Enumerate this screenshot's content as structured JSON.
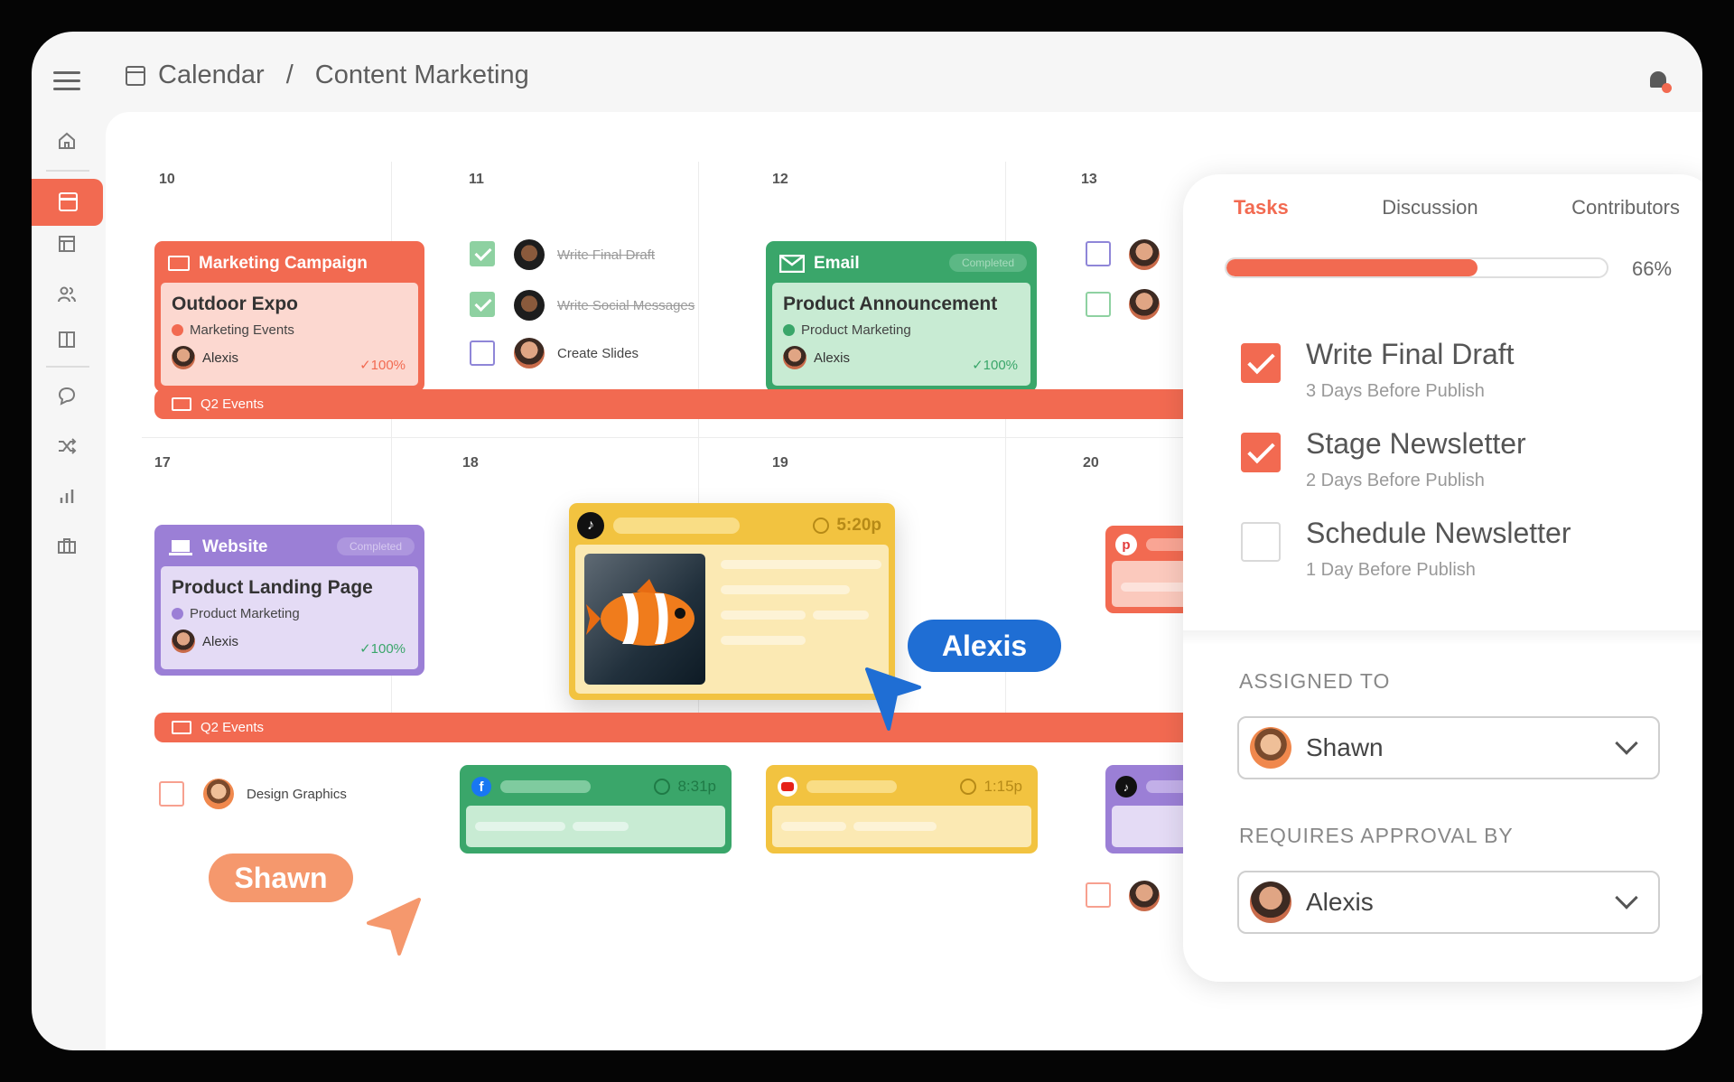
{
  "header": {
    "breadcrumb_root": "Calendar",
    "breadcrumb_sep": "/",
    "breadcrumb_page": "Content Marketing"
  },
  "sidebar": {
    "icons": [
      "home-icon",
      "calendar-icon",
      "layout-icon",
      "users-icon",
      "columns-icon",
      "chat-icon",
      "shuffle-icon",
      "bar-chart-icon",
      "briefcase-icon"
    ]
  },
  "calendar": {
    "week1": {
      "days": [
        "10",
        "11",
        "12",
        "13"
      ],
      "marketing_card": {
        "head": "Marketing Campaign",
        "title": "Outdoor Expo",
        "tag": "Marketing Events",
        "owner": "Alexis",
        "progress": "✓100%"
      },
      "tasks": [
        {
          "label": "Write Final Draft",
          "done": true
        },
        {
          "label": "Write Social Messages",
          "done": true
        },
        {
          "label": "Create Slides",
          "done": false
        }
      ],
      "email_card": {
        "head": "Email",
        "badge": "Completed",
        "title": "Product Announcement",
        "tag": "Product Marketing",
        "owner": "Alexis",
        "progress": "✓100%"
      }
    },
    "band1": "Q2 Events",
    "week2": {
      "days": [
        "17",
        "18",
        "19",
        "20"
      ],
      "website_card": {
        "head": "Website",
        "badge": "Completed",
        "title": "Product Landing Page",
        "tag": "Product Marketing",
        "owner": "Alexis",
        "progress": "✓100%"
      },
      "tiktok_card": {
        "time": "5:20p"
      }
    },
    "band2": "Q2 Events",
    "week3": {
      "task": "Design Graphics",
      "facebook_time": "8:31p",
      "youtube_time": "1:15p"
    }
  },
  "cursors": {
    "alexis": "Alexis",
    "shawn": "Shawn"
  },
  "panel": {
    "tabs": [
      "Tasks",
      "Discussion",
      "Contributors"
    ],
    "progress_label": "66%",
    "progress_value": 0.66,
    "tasks": [
      {
        "title": "Write Final Draft",
        "due": "3 Days Before Publish",
        "done": true
      },
      {
        "title": "Stage Newsletter",
        "due": "2 Days Before Publish",
        "done": true
      },
      {
        "title": "Schedule Newsletter",
        "due": "1 Day Before Publish",
        "done": false
      }
    ],
    "assigned_label": "ASSIGNED TO",
    "assigned_value": "Shawn",
    "approval_label": "REQUIRES APPROVAL BY",
    "approval_value": "Alexis"
  },
  "colors": {
    "accent": "#f26a51",
    "email": "#3aa66a",
    "website": "#9b7fd6",
    "tiktok": "#f2c340"
  }
}
